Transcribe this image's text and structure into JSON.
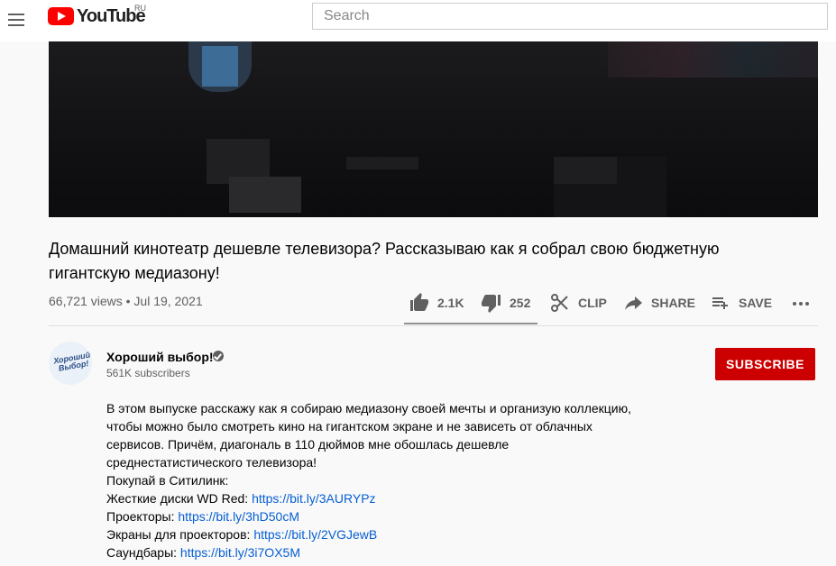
{
  "header": {
    "logo_text": "YouTube",
    "region": "RU",
    "search_placeholder": "Search"
  },
  "video": {
    "title_line1": "Домашний кинотеатр дешевле телевизора? Рассказываю как я собрал свою бюджетную",
    "title_line2": "гигантскую медиазону!",
    "views": "66,721 views",
    "date": "Jul 19, 2021",
    "likes": "2.1K",
    "dislikes": "252",
    "clip_label": "CLIP",
    "share_label": "SHARE",
    "save_label": "SAVE"
  },
  "channel": {
    "avatar_text_line1": "Хороший",
    "avatar_text_line2": "Выбор!",
    "name": "Хороший выбор!",
    "subscribers": "561K subscribers",
    "subscribe_label": "SUBSCRIBE"
  },
  "description": {
    "paragraph_lines": [
      "В этом выпуске расскажу как я собираю медиазону своей мечты и организую коллекцию,",
      "чтобы можно было смотреть кино на гигантском экране и не зависеть от облачных",
      "сервисов. Причём, диагональ в 110 дюймов мне обошлась дешевле",
      "среднестатистического телевизора!"
    ],
    "shop_heading": "Покупай в Ситилинк:",
    "links": [
      {
        "label": "Жесткие диски WD Red: ",
        "url": "https://bit.ly/3AURYPz"
      },
      {
        "label": "Проекторы: ",
        "url": "https://bit.ly/3hD50cM"
      },
      {
        "label": "Экраны для проекторов: ",
        "url": "https://bit.ly/2VGJewB"
      },
      {
        "label": "Саундбары: ",
        "url": "https://bit.ly/3i7OX5M"
      }
    ]
  },
  "colors": {
    "accent_red": "#cc0000",
    "link_blue": "#065fd4",
    "secondary_text": "#606060"
  }
}
